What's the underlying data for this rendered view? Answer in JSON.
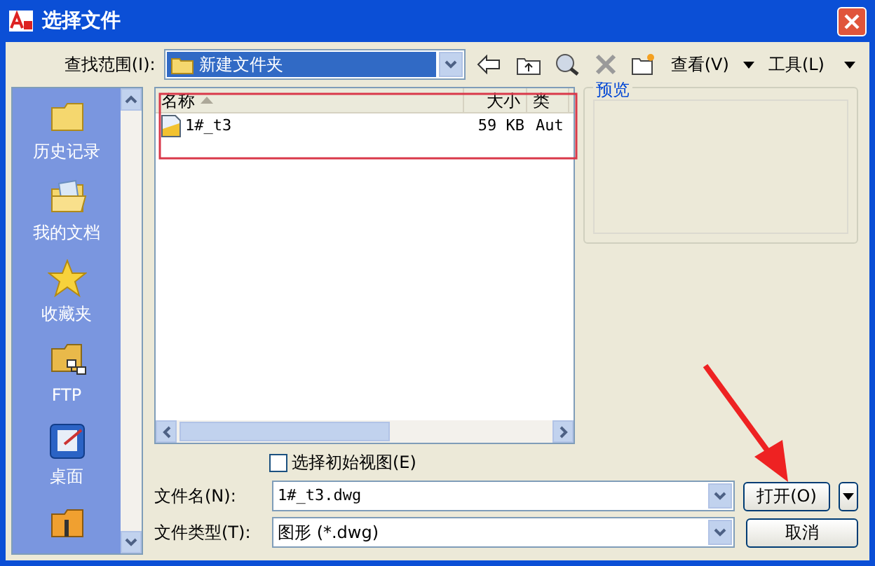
{
  "window": {
    "title": "选择文件"
  },
  "look_in": {
    "label": "查找范围(I):",
    "value": "新建文件夹"
  },
  "toolbar": {
    "view_label": "查看(V)",
    "tools_label": "工具(L)"
  },
  "places": [
    {
      "label": "历史记录",
      "kind": "history"
    },
    {
      "label": "我的文档",
      "kind": "documents"
    },
    {
      "label": "收藏夹",
      "kind": "favorites"
    },
    {
      "label": "FTP",
      "kind": "ftp"
    },
    {
      "label": "桌面",
      "kind": "desktop"
    },
    {
      "kind": "folder"
    }
  ],
  "file_list": {
    "columns": [
      {
        "label": "名称",
        "sorted": true
      },
      {
        "label": "大小",
        "sorted": false
      },
      {
        "label": "类",
        "sorted": false
      }
    ],
    "rows": [
      {
        "name": "1#_t3",
        "size": "59 KB",
        "type": "Aut"
      }
    ]
  },
  "preview": {
    "label": "预览"
  },
  "initial_view": {
    "label": "选择初始视图(E)",
    "checked": false
  },
  "file_name": {
    "label": "文件名(N):",
    "value": "1#_t3.dwg"
  },
  "file_type": {
    "label": "文件类型(T):",
    "value": "图形 (*.dwg)"
  },
  "buttons": {
    "open": "打开(O)",
    "cancel": "取消"
  }
}
